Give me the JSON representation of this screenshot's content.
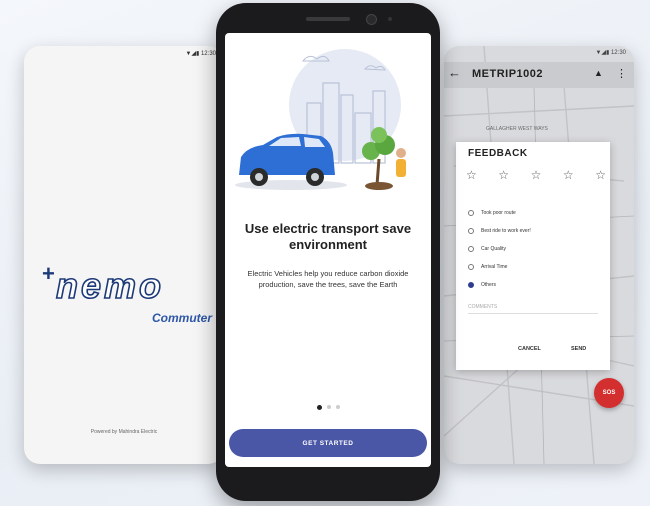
{
  "left_screen": {
    "status": "▼◢▮ 12:30",
    "logo": {
      "plus": "+",
      "word": "nemo",
      "subtitle": "Commuter"
    },
    "powered_by": "Powered by Mahindra Electric"
  },
  "center_screen": {
    "headline": "Use electric transport save environment",
    "body": "Electric Vehicles help you reduce carbon dioxide production, save the trees, save the Earth",
    "pager": {
      "count": 3,
      "active_index": 0
    },
    "cta_label": "GET STARTED"
  },
  "right_screen": {
    "status": "▼◢▮ 12:30",
    "header": {
      "back_icon": "arrow-left-icon",
      "title": "METRIP1002",
      "icon1": "bell-icon",
      "icon2": "more-vert-icon"
    },
    "map_label": "GALLAGHER WEST WAYS",
    "feedback": {
      "title": "FEEDBACK",
      "stars": [
        "☆",
        "☆",
        "☆",
        "☆",
        "☆"
      ],
      "options": [
        {
          "label": "Took poor route",
          "selected": false
        },
        {
          "label": "Best ride to work ever!",
          "selected": false
        },
        {
          "label": "Car Quality",
          "selected": false
        },
        {
          "label": "Arrival Time",
          "selected": false
        },
        {
          "label": "Others",
          "selected": true
        }
      ],
      "comments_placeholder": "COMMENTS",
      "cancel_label": "CANCEL",
      "send_label": "SEND"
    },
    "sos_label": "SOS"
  },
  "colors": {
    "accent": "#4a56a6",
    "logo_blue": "#1d3a78",
    "sos_red": "#d32f2f"
  }
}
